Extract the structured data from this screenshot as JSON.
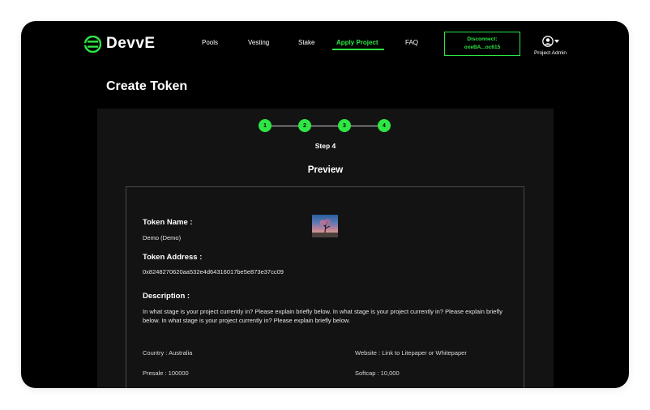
{
  "brand": {
    "name": "DevvE",
    "accent": "#2ee643"
  },
  "nav": {
    "items": [
      {
        "label": "Pools"
      },
      {
        "label": "Vesting"
      },
      {
        "label": "Stake"
      },
      {
        "label": "Apply Project"
      },
      {
        "label": "FAQ"
      }
    ],
    "active": "Apply Project"
  },
  "wallet": {
    "line1": "Disconnect:",
    "line2": "oxeBA...oc615"
  },
  "account": {
    "label": "Project Admin",
    "icon": "user-circle-icon"
  },
  "page": {
    "title": "Create Token"
  },
  "stepper": {
    "steps": [
      "1",
      "2",
      "3",
      "4"
    ],
    "current_label": "Step 4"
  },
  "preview": {
    "title": "Preview",
    "token_name_label": "Token Name :",
    "token_name_value": "Demo (Demo)",
    "token_address_label": "Token Address :",
    "token_address_value": "0x8248270620aa532e4d64316017be5e873e37cc09",
    "description_label": "Description :",
    "description_value": "In what stage is your project currently in? Please explain briefly below. In what stage is your project currently in? Please explain briefly below. In what stage is your project currently in? Please explain briefly below.",
    "country": "Country : Australia",
    "website": "Website : Link to Litepaper or Whitepaper",
    "presale": "Presale : 100000",
    "softcap": "Softcap : 10,000"
  }
}
